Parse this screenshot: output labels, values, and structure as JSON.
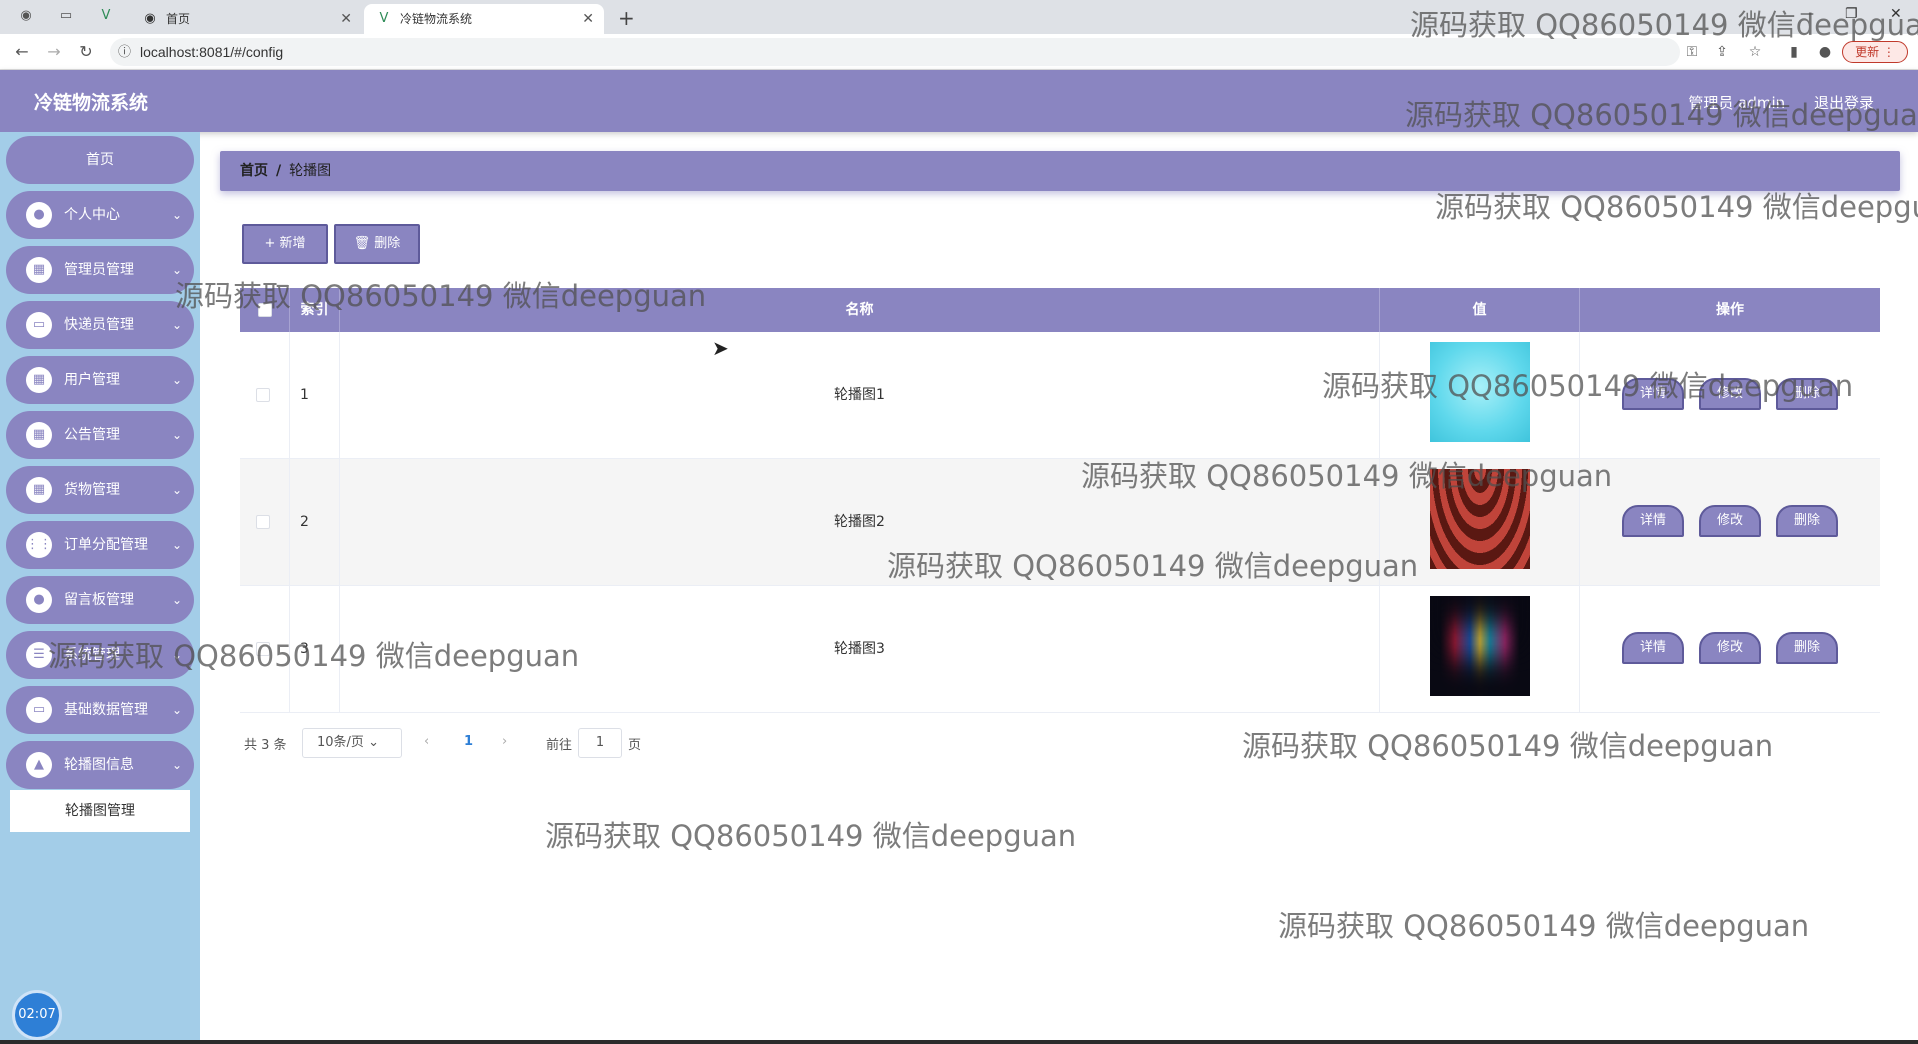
{
  "browser": {
    "tabs": [
      {
        "label": "首页",
        "active": false
      },
      {
        "label": "冷链物流系统",
        "active": true
      }
    ],
    "url": "localhost:8081/#/config",
    "update_label": "更新"
  },
  "header": {
    "title": "冷链物流系统",
    "user": "管理员 admin",
    "logout": "退出登录"
  },
  "sidebar": {
    "home": "首页",
    "items": [
      {
        "label": "个人中心",
        "icon": "user-icon"
      },
      {
        "label": "管理员管理",
        "icon": "grid-icon"
      },
      {
        "label": "快递员管理",
        "icon": "monitor-icon"
      },
      {
        "label": "用户管理",
        "icon": "grid-icon"
      },
      {
        "label": "公告管理",
        "icon": "grid-icon"
      },
      {
        "label": "货物管理",
        "icon": "grid-icon"
      },
      {
        "label": "订单分配管理",
        "icon": "apps-icon"
      },
      {
        "label": "留言板管理",
        "icon": "user-icon"
      },
      {
        "label": "系统管理",
        "icon": "sliders-icon"
      },
      {
        "label": "基础数据管理",
        "icon": "monitor-icon"
      },
      {
        "label": "轮播图信息",
        "icon": "image-icon"
      }
    ],
    "submenu": "轮播图管理",
    "clock": "02:07"
  },
  "breadcrumb": {
    "home": "首页",
    "current": "轮播图"
  },
  "toolbar": {
    "add": "+ 新增",
    "delete": "🗑 删除"
  },
  "table": {
    "headers": {
      "index": "索引",
      "name": "名称",
      "value": "值",
      "ops": "操作"
    },
    "rows": [
      {
        "index": "1",
        "name": "轮播图1",
        "image_color": "#5fd8ec"
      },
      {
        "index": "2",
        "name": "轮播图2",
        "image_color": "#8a2a22"
      },
      {
        "index": "3",
        "name": "轮播图3",
        "image_color": "#0a0a14"
      }
    ],
    "ops": {
      "detail": "详情",
      "edit": "修改",
      "delete": "删除"
    }
  },
  "pagination": {
    "total": "共 3 条",
    "page_size": "10条/页",
    "current": "1",
    "goto": "前往",
    "jump_value": "1",
    "page_unit": "页"
  },
  "watermark": "源码获取 QQ86050149 微信deepguan",
  "colors": {
    "accent": "#8a85c1",
    "sidebar": "#a3cde8"
  }
}
